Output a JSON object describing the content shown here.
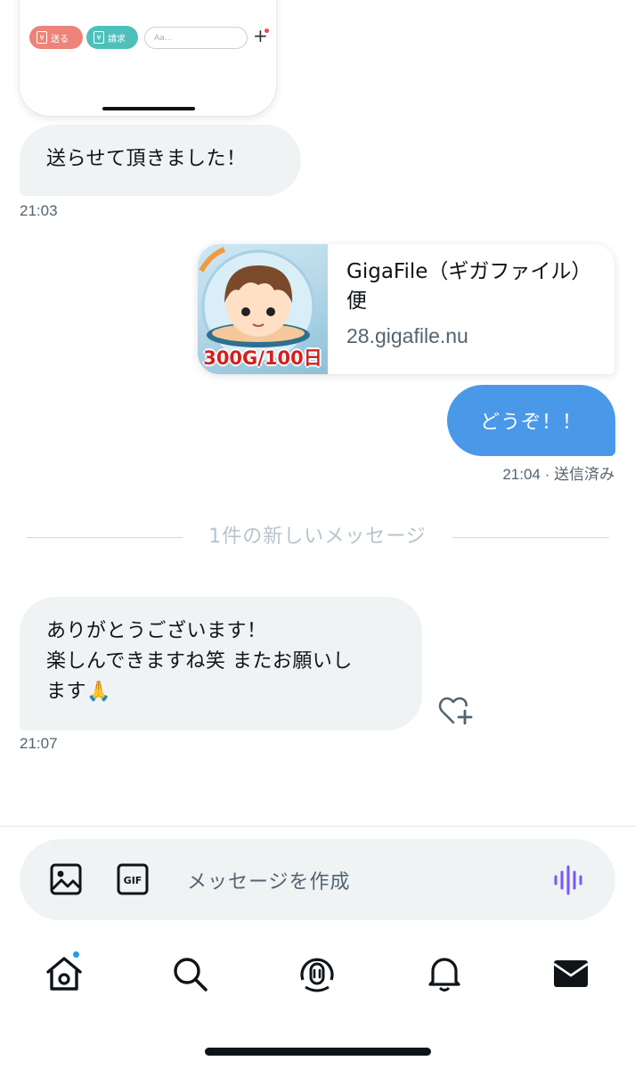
{
  "embedded_screenshot": {
    "send_label": "送る",
    "request_label": "請求",
    "yen_symbol": "¥",
    "input_placeholder": "Aa...",
    "plus": "+"
  },
  "messages": [
    {
      "direction": "in",
      "text": "送らせて頂きました！",
      "time": "21:03"
    },
    {
      "direction": "out",
      "type": "link",
      "link_title": "GigaFile（ギガファイル）便",
      "link_domain": "28.gigafile.nu",
      "thumbnail_text": "300G/100日"
    },
    {
      "direction": "out",
      "text": "どうぞ！！",
      "time": "21:04 · 送信済み"
    },
    {
      "direction": "in",
      "lines": [
        "ありがとうございます！",
        "楽しんできますね笑 またお願いし",
        "ます🙏"
      ],
      "time": "21:07"
    }
  ],
  "divider": {
    "new_messages": "1件の新しいメッセージ"
  },
  "composer": {
    "placeholder": "メッセージを作成",
    "gif_label": "GIF"
  },
  "nav": {
    "items": [
      "home-icon",
      "search-icon",
      "spaces-icon",
      "bell-icon",
      "mail-icon"
    ],
    "home_badge": true
  },
  "colors": {
    "accent": "#1d9bf0",
    "out_bubble": "#4a99e9",
    "in_bubble": "#eff3f4",
    "voice_icon": "#7856ff"
  }
}
